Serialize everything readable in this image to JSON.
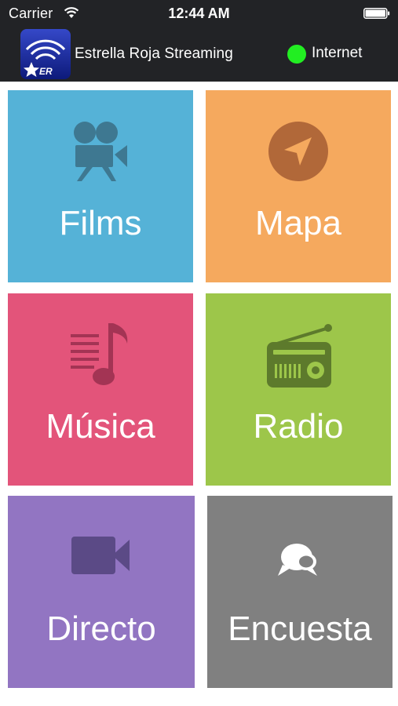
{
  "status_bar": {
    "carrier": "Carrier",
    "time": "12:44 AM"
  },
  "nav": {
    "title": "Estrella Roja Streaming",
    "connection_label": "Internet",
    "connection_color": "#22ee22",
    "logo_icon": "estrella-roja-logo",
    "logo_text": "ER"
  },
  "tiles": [
    {
      "label": "Films",
      "icon": "film-camera-icon",
      "color": "#55b2d7"
    },
    {
      "label": "Mapa",
      "icon": "location-arrow-icon",
      "color": "#f5a95e"
    },
    {
      "label": "Música",
      "icon": "music-note-icon",
      "color": "#e3547a"
    },
    {
      "label": "Radio",
      "icon": "radio-icon",
      "color": "#9dc64a"
    },
    {
      "label": "Directo",
      "icon": "video-camera-icon",
      "color": "#9275c2"
    },
    {
      "label": "Encuesta",
      "icon": "chat-bubbles-icon",
      "color": "#808080"
    }
  ]
}
